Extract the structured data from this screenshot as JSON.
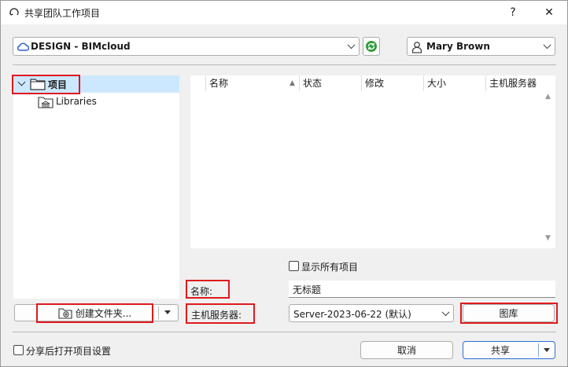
{
  "window": {
    "title": "共享团队工作项目",
    "help_label": "?",
    "close_label": "✕"
  },
  "server": {
    "name": "DESIGN - BIMcloud"
  },
  "user": {
    "name": "Mary Brown"
  },
  "tree": {
    "root_label": "项目",
    "child_label": "Libraries"
  },
  "table": {
    "columns": [
      "名称",
      "状态",
      "修改",
      "大小",
      "主机服务器"
    ]
  },
  "show_all_label": "显示所有项目",
  "form": {
    "name_label": "名称:",
    "name_value": "无标题",
    "host_label": "主机服务器:",
    "host_value": "Server-2023-06-22 (默认)",
    "library_button": "图库"
  },
  "create_folder_label": "创建文件夹...",
  "open_settings_label": "分享后打开项目设置",
  "footer": {
    "cancel_label": "取消",
    "share_label": "共享"
  },
  "colors": {
    "highlight": "#e0191c",
    "selection": "#cce8ff",
    "sync_green": "#2f9e3a"
  }
}
